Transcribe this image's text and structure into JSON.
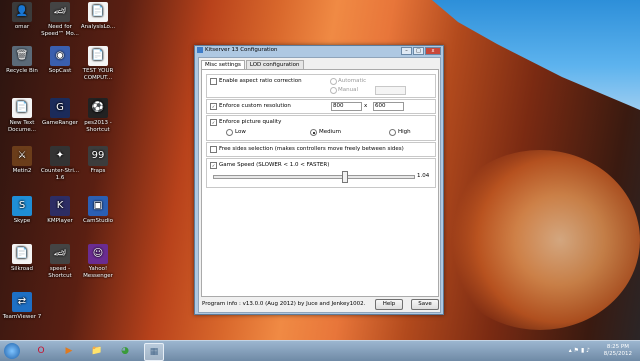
{
  "desktop": {
    "icons": [
      {
        "label": "omar",
        "glyph": "👤",
        "color": "#3b3b3b"
      },
      {
        "label": "Need for Speed™ Mo...",
        "glyph": "🏎",
        "color": "#444"
      },
      {
        "label": "AnalysisLo...",
        "glyph": "📄",
        "color": "#f4f4f4"
      },
      {
        "label": "Recycle Bin",
        "glyph": "🗑",
        "color": "#5b6a78"
      },
      {
        "label": "SopCast",
        "glyph": "◉",
        "color": "#3a5fae"
      },
      {
        "label": "TEST YOUR COMPUT...",
        "glyph": "📄",
        "color": "#f4f4f4"
      },
      {
        "label": "New Text Docume...",
        "glyph": "📄",
        "color": "#f4f4f4"
      },
      {
        "label": "GameRanger",
        "glyph": "G",
        "color": "#1b2b5a"
      },
      {
        "label": "pes2013 - Shortcut",
        "glyph": "⚽",
        "color": "#222"
      },
      {
        "label": "Metin2",
        "glyph": "⚔",
        "color": "#6b3d1a"
      },
      {
        "label": "Counter-Stri... 1.6",
        "glyph": "✦",
        "color": "#333"
      },
      {
        "label": "Fraps",
        "glyph": "99",
        "color": "#3c3c3c"
      },
      {
        "label": "Skype",
        "glyph": "S",
        "color": "#1f8ed6"
      },
      {
        "label": "KMPlayer",
        "glyph": "K",
        "color": "#2d2d64"
      },
      {
        "label": "CamStudio",
        "glyph": "▣",
        "color": "#2b5fb3"
      },
      {
        "label": "Silkroad",
        "glyph": "📄",
        "color": "#f4f4f4"
      },
      {
        "label": "speed - Shortcut",
        "glyph": "🏎",
        "color": "#444"
      },
      {
        "label": "Yahoo! Messenger",
        "glyph": "☺",
        "color": "#6a2c91"
      },
      {
        "label": "TeamViewer 7",
        "glyph": "⇄",
        "color": "#1e6fc4"
      }
    ]
  },
  "window": {
    "title": "Kitserver 13 Configuration",
    "minimize": "–",
    "maximize": "□",
    "close": "x",
    "tabs": [
      "Misc settings",
      "LOD configuration"
    ],
    "aspect": {
      "label": "Enable aspect ratio correction",
      "checked": false,
      "automatic_label": "Automatic",
      "manual_label": "Manual",
      "manual_value": ""
    },
    "resolution": {
      "label": "Enforce custom resolution",
      "checked": true,
      "width": "800",
      "separator": "x",
      "height": "600"
    },
    "quality": {
      "label": "Enforce picture quality",
      "checked": true,
      "options": [
        "Low",
        "Medium",
        "High"
      ],
      "selected": "Medium"
    },
    "free_sides": {
      "label": "Free sides selection  (makes controllers move freely between sides)",
      "checked": false
    },
    "game_speed": {
      "label": "Game Speed (SLOWER < 1.0 < FASTER)",
      "checked": true,
      "value_text": "1.04",
      "slider_fraction": 0.66
    },
    "program_info": "Program info : v13.0.0 (Aug 2012) by Juce and Jenkey1002.",
    "help_label": "Help",
    "save_label": "Save"
  },
  "taskbar": {
    "time": "8:25 PM",
    "date": "8/25/2012",
    "items": [
      {
        "name": "opera",
        "glyph": "O",
        "color": "#c8102e"
      },
      {
        "name": "media-player",
        "glyph": "▶",
        "color": "#e07a1f"
      },
      {
        "name": "explorer",
        "glyph": "📁",
        "color": "#d9b44a"
      },
      {
        "name": "chrome",
        "glyph": "◕",
        "color": "#3a9b3a"
      },
      {
        "name": "kitserver-config",
        "glyph": "▦",
        "color": "#4a6a8c"
      }
    ]
  }
}
